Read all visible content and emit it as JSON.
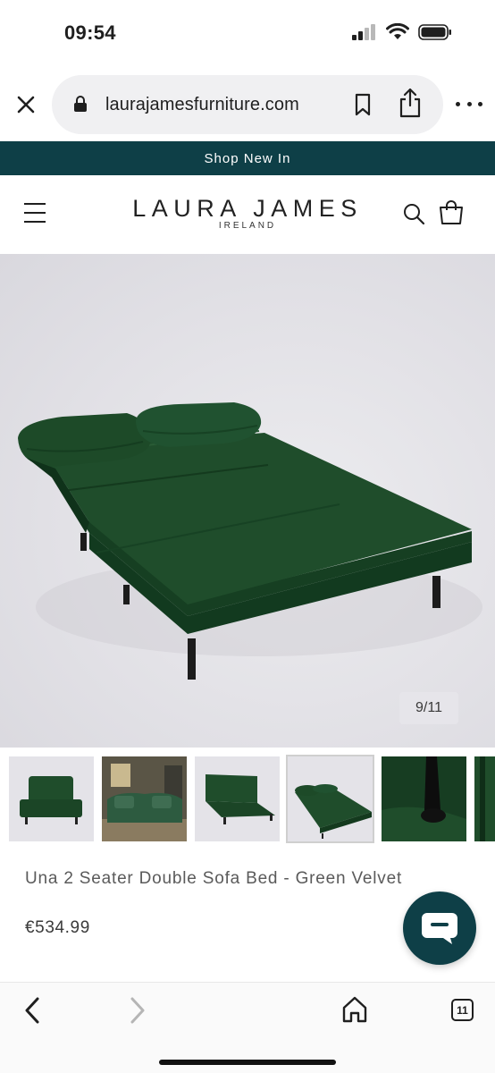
{
  "status": {
    "time": "09:54"
  },
  "browser": {
    "url": "laurajamesfurniture.com",
    "open_tabs": "11"
  },
  "announcement": {
    "text": "Shop New In"
  },
  "header": {
    "logo_main": "LAURA JAMES",
    "logo_sub": "IRELAND"
  },
  "gallery": {
    "counter": "9/11",
    "current_index": 9,
    "total": 11
  },
  "product": {
    "title": "Una 2 Seater Double Sofa Bed - Green Velvet",
    "price": "€534.99"
  },
  "colors": {
    "brand": "#0e3f47",
    "velvet": "#1f4d2b"
  },
  "icons": [
    "close-icon",
    "lock-icon",
    "bookmark-icon",
    "share-icon",
    "more-icon",
    "menu-icon",
    "search-icon",
    "cart-icon",
    "chat-icon",
    "back-icon",
    "forward-icon",
    "home-icon",
    "tabs-icon"
  ]
}
